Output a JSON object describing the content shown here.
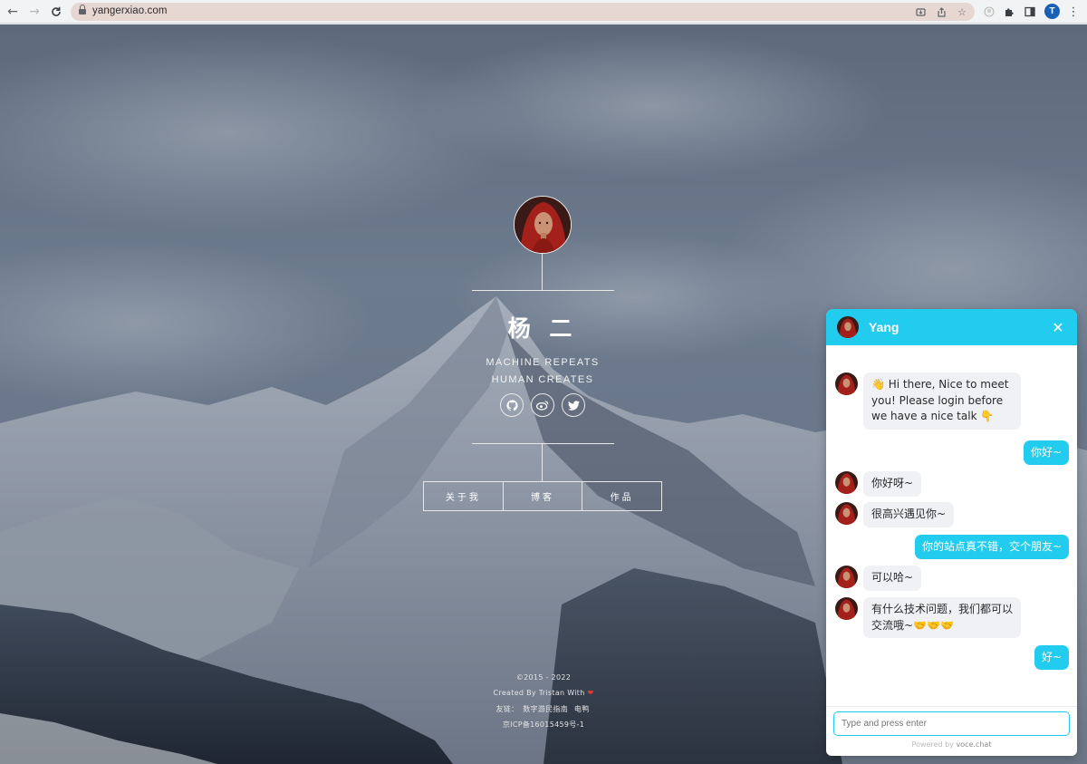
{
  "browser": {
    "url": "yangerxiao.com",
    "profile_initial": "T",
    "icons": [
      "back-icon",
      "forward-icon",
      "reload-icon",
      "lock-icon",
      "install-icon",
      "share-icon",
      "bookmark-star-icon",
      "extension-avatar-icon",
      "extensions-puzzle-icon",
      "side-panel-icon",
      "profile-icon",
      "menu-kebab-icon"
    ]
  },
  "profile": {
    "name": "杨 二",
    "tagline_1": "MACHINE REPEATS",
    "tagline_2": "HUMAN CREATES",
    "social": [
      "github-icon",
      "weibo-icon",
      "twitter-icon"
    ]
  },
  "menu": {
    "items": [
      "关于我",
      "博客",
      "作品"
    ]
  },
  "footer": {
    "copyright": "©2015 - 2022",
    "created_by": "Created By Tristan With",
    "friends_label": "友链：",
    "friend_link_1": "数字游民指南",
    "friend_link_2": "电鸭",
    "icp": "京ICP备16015459号-1"
  },
  "chat": {
    "title": "Yang",
    "messages": [
      {
        "from": "agent",
        "text": "👋 Hi there, Nice to meet you! Please login before we have a nice talk 👇"
      },
      {
        "from": "user",
        "text": "你好~"
      },
      {
        "from": "agent",
        "text": "你好呀~"
      },
      {
        "from": "agent",
        "text": "很高兴遇见你~"
      },
      {
        "from": "user",
        "text": "你的站点真不错，交个朋友~"
      },
      {
        "from": "agent",
        "text": "可以哈~"
      },
      {
        "from": "agent",
        "text": "有什么技术问题，我们都可以交流哦~🤝🤝🤝"
      },
      {
        "from": "user",
        "text": "好~"
      }
    ],
    "input_placeholder": "Type and press enter",
    "powered_prefix": "Powered by",
    "powered_brand": "voce.chat"
  },
  "colors": {
    "chat_accent": "#22ccee",
    "omnibox": "#e6d7d2",
    "profile_badge": "#1a5fb4"
  }
}
